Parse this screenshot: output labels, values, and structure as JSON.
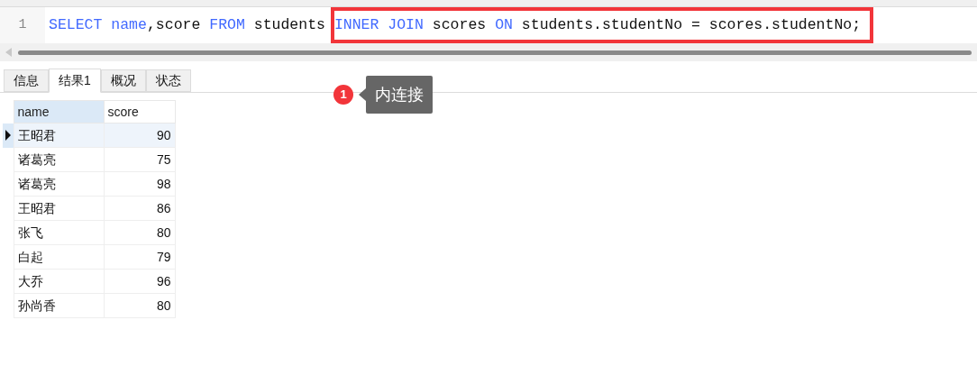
{
  "editor": {
    "line_number": "1",
    "code_before": [
      {
        "text": "SELECT ",
        "kind": "keyword"
      },
      {
        "text": "name",
        "kind": "keyword"
      },
      {
        "text": ",score ",
        "kind": "plain"
      },
      {
        "text": "FROM",
        "kind": "keyword"
      },
      {
        "text": " students ",
        "kind": "plain"
      }
    ],
    "code_highlighted": [
      {
        "text": "INNER JOIN",
        "kind": "keyword"
      },
      {
        "text": " scores ",
        "kind": "plain"
      },
      {
        "text": "ON",
        "kind": "keyword"
      },
      {
        "text": " students.studentNo = scores.studentNo;",
        "kind": "plain"
      }
    ]
  },
  "result_tabs": [
    {
      "label": "信息",
      "selected": false
    },
    {
      "label": "结果1",
      "selected": true
    },
    {
      "label": "概况",
      "selected": false
    },
    {
      "label": "状态",
      "selected": false
    }
  ],
  "callout": {
    "badge": "1",
    "label": "内连接"
  },
  "table": {
    "columns": [
      "name",
      "score"
    ],
    "rows": [
      {
        "name": "王昭君",
        "score": "90",
        "selected": true
      },
      {
        "name": "诸葛亮",
        "score": "75",
        "selected": false
      },
      {
        "name": "诸葛亮",
        "score": "98",
        "selected": false
      },
      {
        "name": "王昭君",
        "score": "86",
        "selected": false
      },
      {
        "name": "张飞",
        "score": "80",
        "selected": false
      },
      {
        "name": "白起",
        "score": "79",
        "selected": false
      },
      {
        "name": "大乔",
        "score": "96",
        "selected": false
      },
      {
        "name": "孙尚香",
        "score": "80",
        "selected": false
      }
    ]
  }
}
